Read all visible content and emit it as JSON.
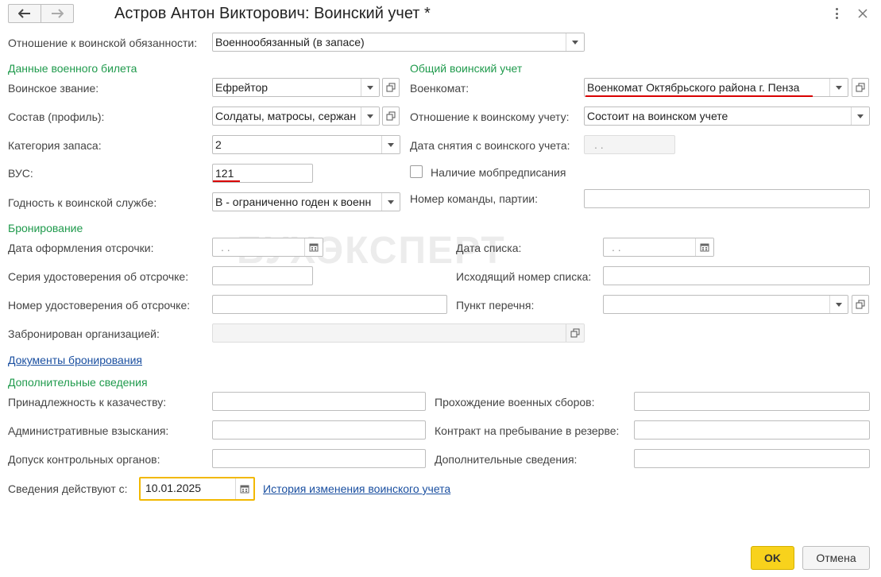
{
  "header": {
    "title": "Астров Антон Викторович: Воинский учет *",
    "back_icon": "arrow-left-icon",
    "forward_icon": "arrow-right-icon",
    "more_icon": "more-vertical-icon",
    "close_icon": "close-icon"
  },
  "relation": {
    "label": "Отношение к воинской обязанности:",
    "value": "Военнообязанный (в запасе)"
  },
  "military_ticket": {
    "section": "Данные военного билета",
    "rank": {
      "label": "Воинское звание:",
      "value": "Ефрейтор"
    },
    "composition": {
      "label": "Состав (профиль):",
      "value": "Солдаты, матросы, сержан"
    },
    "category": {
      "label": "Категория запаса:",
      "value": "2"
    },
    "vus": {
      "label": "ВУС:",
      "value": "121"
    },
    "fitness": {
      "label": "Годность к воинской службе:",
      "value": "В - ограниченно годен к военн"
    }
  },
  "general": {
    "section": "Общий воинский учет",
    "commissariat": {
      "label": "Военкомат:",
      "value": "Военкомат Октябрьского района г. Пенза"
    },
    "relation_to_accounting": {
      "label": "Отношение к воинскому учету:",
      "value": "Состоит на воинском учете"
    },
    "removal_date": {
      "label": "Дата снятия с воинского учета:",
      "value": " .  ."
    },
    "mob_order": {
      "label": "Наличие мобпредписания",
      "checked": false
    },
    "team_number": {
      "label": "Номер команды, партии:",
      "value": ""
    }
  },
  "booking": {
    "section": "Бронирование",
    "deferral_date": {
      "label": "Дата оформления отсрочки:",
      "value": " .  ."
    },
    "cert_series": {
      "label": "Серия удостоверения об отсрочке:",
      "value": ""
    },
    "cert_number": {
      "label": "Номер удостоверения об отсрочке:",
      "value": ""
    },
    "booked_by": {
      "label": "Забронирован организацией:",
      "value": ""
    },
    "list_date": {
      "label": "Дата списка:",
      "value": " .  ."
    },
    "outgoing_number": {
      "label": "Исходящий номер списка:",
      "value": ""
    },
    "list_item": {
      "label": "Пункт перечня:",
      "value": ""
    },
    "docs_link": "Документы бронирования"
  },
  "watermark": "БУХЭКСПЕРТ",
  "additional": {
    "section": "Дополнительные сведения",
    "cossack": {
      "label": "Принадлежность к казачеству:",
      "value": ""
    },
    "penalties": {
      "label": "Административные взыскания:",
      "value": ""
    },
    "control_access": {
      "label": "Допуск контрольных органов:",
      "value": ""
    },
    "training": {
      "label": "Прохождение военных сборов:",
      "value": ""
    },
    "reserve_contract": {
      "label": "Контракт на пребывание в резерве:",
      "value": ""
    },
    "extra_info": {
      "label": "Дополнительные сведения:",
      "value": ""
    }
  },
  "effective": {
    "label": "Сведения действуют с:",
    "value": "10.01.2025",
    "history_link": "История изменения воинского учета"
  },
  "buttons": {
    "ok": "OK",
    "cancel": "Отмена"
  },
  "colors": {
    "section": "#1f9a4c",
    "link": "#1a4fa0",
    "ok_button": "#f8d21c",
    "highlight_border": "#f2b800",
    "underline": "#d90000"
  }
}
